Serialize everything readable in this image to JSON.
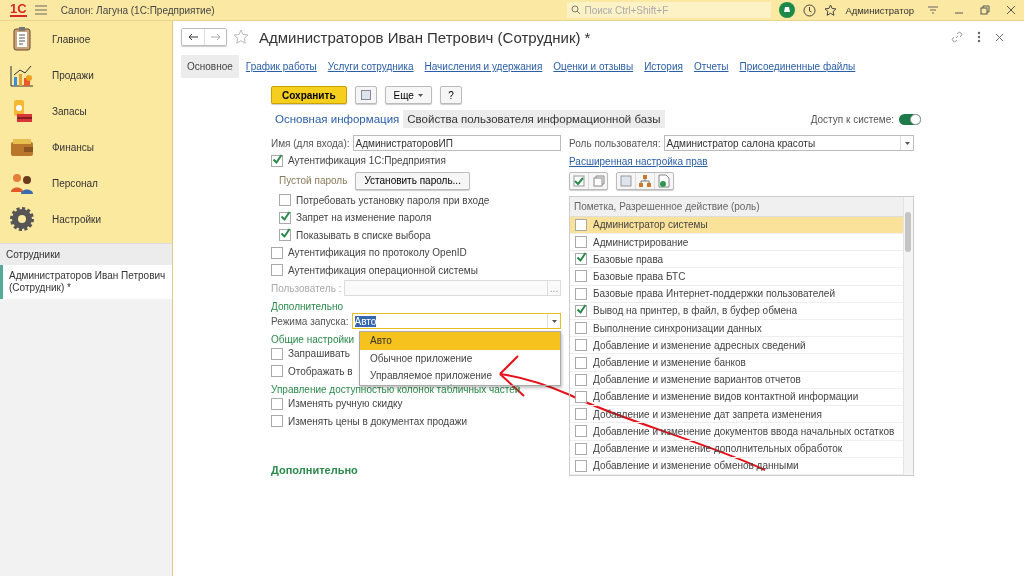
{
  "top_bar": {
    "logo": "1С",
    "title": "Салон: Лагуна  (1С:Предприятие)",
    "search_placeholder": "Поиск Ctrl+Shift+F",
    "user": "Администратор"
  },
  "sidebar": {
    "sections": [
      {
        "label": "Главное",
        "kind": "clipboard"
      },
      {
        "label": "Продажи",
        "kind": "chart"
      },
      {
        "label": "Запасы",
        "kind": "boxes"
      },
      {
        "label": "Финансы",
        "kind": "wallet"
      },
      {
        "label": "Персонал",
        "kind": "people"
      },
      {
        "label": "Настройки",
        "kind": "gear"
      }
    ],
    "open_title": "Сотрудники",
    "open_windows": [
      {
        "label": "Администраторов Иван Петрович (Сотрудник) *",
        "selected": true
      }
    ]
  },
  "form": {
    "title": "Администраторов Иван Петрович (Сотрудник) *",
    "tabs": [
      {
        "label": "Основное",
        "selected": true
      },
      {
        "label": "График работы",
        "selected": false
      },
      {
        "label": "Услуги сотрудника",
        "selected": false
      },
      {
        "label": "Начисления и удержания",
        "selected": false
      },
      {
        "label": "Оценки и отзывы",
        "selected": false
      },
      {
        "label": "История",
        "selected": false
      },
      {
        "label": "Отчеты",
        "selected": false
      },
      {
        "label": "Присоединенные файлы",
        "selected": false
      }
    ],
    "save_button": "Сохранить",
    "more_button": "Еще",
    "help_button": "?",
    "group_tabs": [
      {
        "label": "Основная информация",
        "selected": false
      },
      {
        "label": "Свойства пользователя информационной базы",
        "selected": true
      }
    ],
    "access": {
      "label": "Доступ к системе:",
      "on": true
    },
    "login": {
      "label": "Имя (для входа):",
      "value": "АдминистраторовИП"
    },
    "auth_1c": {
      "label": "Аутентификация 1С:Предприятия",
      "checked": true
    },
    "empty_password": "Пустой пароль",
    "set_password_button": "Установить пароль...",
    "password_options": [
      {
        "label": "Потребовать установку пароля при входе",
        "checked": false
      },
      {
        "label": "Запрет на изменение пароля",
        "checked": true
      },
      {
        "label": "Показывать в списке выбора",
        "checked": true
      }
    ],
    "auth_options": [
      {
        "label": "Аутентификация по протоколу OpenID",
        "checked": false
      },
      {
        "label": "Аутентификация операционной системы",
        "checked": false
      }
    ],
    "os_user": {
      "label": "Пользователь :",
      "button": "..."
    },
    "extra_title": "Дополнительно",
    "launch": {
      "label": "Режима запуска:",
      "value": "Авто",
      "options": [
        {
          "label": "Авто",
          "selected": true
        },
        {
          "label": "Обычное приложение",
          "selected": false
        },
        {
          "label": "Управляемое приложение",
          "selected": false
        }
      ]
    },
    "general_title": "Общие настройки",
    "general_options": [
      {
        "label": "Запрашивать",
        "checked": false
      },
      {
        "label": "Отображать в",
        "checked": false
      }
    ],
    "columns_title": "Управление доступностью колонок табличных частей",
    "column_options": [
      {
        "label": "Изменять ручную скидку",
        "checked": false
      },
      {
        "label": "Изменять цены в документах продажи",
        "checked": false
      }
    ],
    "role": {
      "label": "Роль пользователя:",
      "value": "Администратор салона красоты"
    },
    "advanced_link": "Расширенная настройка прав",
    "roles_header": "Пометка, Разрешенное действие (роль)",
    "roles": [
      {
        "label": "Администратор системы",
        "checked": false,
        "selected": true
      },
      {
        "label": "Администрирование",
        "checked": false,
        "selected": false
      },
      {
        "label": "Базовые права",
        "checked": true,
        "selected": false
      },
      {
        "label": "Базовые права БТС",
        "checked": false,
        "selected": false
      },
      {
        "label": "Базовые права Интернет-поддержки пользователей",
        "checked": false,
        "selected": false
      },
      {
        "label": "Вывод на принтер, в файл, в буфер обмена",
        "checked": true,
        "selected": false
      },
      {
        "label": "Выполнение синхронизации данных",
        "checked": false,
        "selected": false
      },
      {
        "label": "Добавление и изменение адресных сведений",
        "checked": false,
        "selected": false
      },
      {
        "label": "Добавление и изменение банков",
        "checked": false,
        "selected": false
      },
      {
        "label": "Добавление и изменение вариантов отчетов",
        "checked": false,
        "selected": false
      },
      {
        "label": "Добавление и изменение видов контактной информации",
        "checked": false,
        "selected": false
      },
      {
        "label": "Добавление и изменение дат запрета изменения",
        "checked": false,
        "selected": false
      },
      {
        "label": "Добавление и изменение документов ввода начальных остатков",
        "checked": false,
        "selected": false
      },
      {
        "label": "Добавление и изменение дополнительных обработок",
        "checked": false,
        "selected": false
      },
      {
        "label": "Добавление и изменение обменов данными",
        "checked": false,
        "selected": false
      }
    ],
    "bottom_title": "Дополнительно"
  }
}
